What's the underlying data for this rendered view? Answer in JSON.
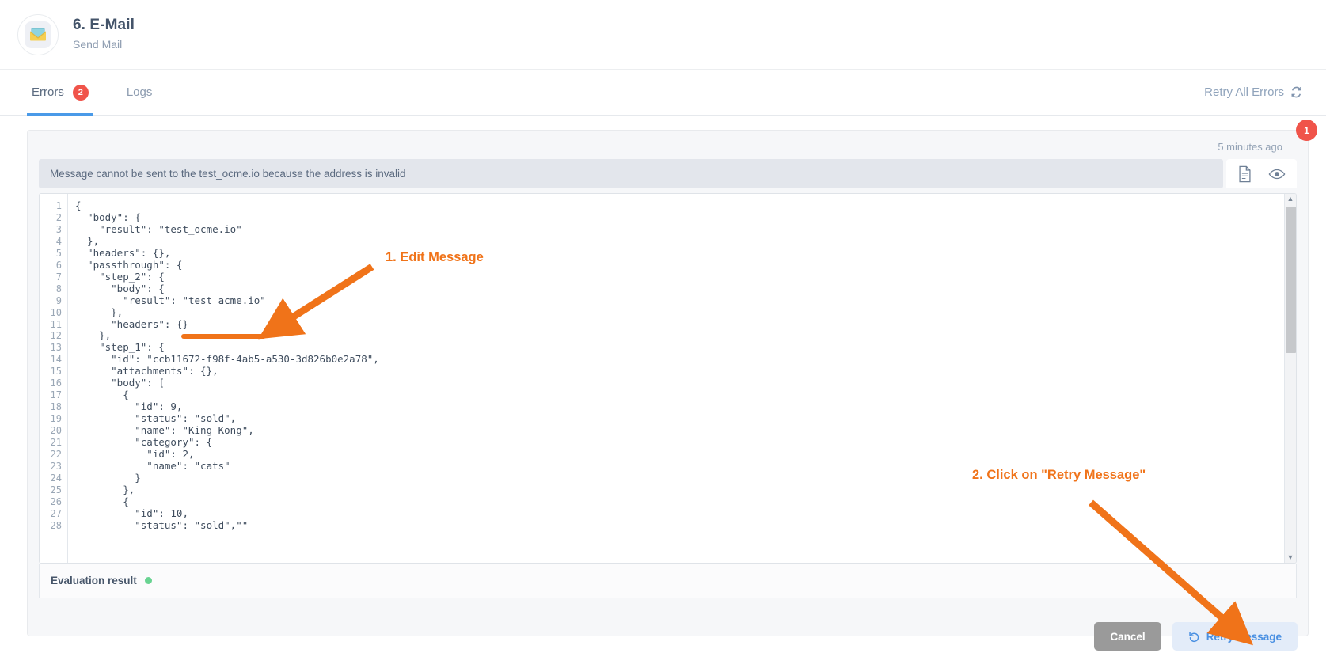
{
  "header": {
    "icon": "envelope-icon",
    "title": "6. E-Mail",
    "subtitle": "Send Mail"
  },
  "tabs": [
    {
      "label": "Errors",
      "badge": "2",
      "active": true
    },
    {
      "label": "Logs",
      "badge": "",
      "active": false
    }
  ],
  "toolbar": {
    "retry_all_label": "Retry All Errors",
    "retry_all_icon": "refresh-icon"
  },
  "panel": {
    "corner_badge": "1",
    "timestamp": "5 minutes ago",
    "error_message": "Message cannot be sent to the test_ocme.io because the address is invalid",
    "tools": [
      {
        "name": "document-icon"
      },
      {
        "name": "eye-icon"
      }
    ]
  },
  "editor": {
    "line_numbers": [
      "1",
      "2",
      "3",
      "4",
      "5",
      "6",
      "7",
      "8",
      "9",
      "10",
      "11",
      "12",
      "13",
      "14",
      "15",
      "16",
      "17",
      "18",
      "19",
      "20",
      "21",
      "22",
      "23",
      "24",
      "25",
      "26",
      "27",
      "28"
    ],
    "code": "{\n  \"body\": {\n    \"result\": \"test_ocme.io\"\n  },\n  \"headers\": {},\n  \"passthrough\": {\n    \"step_2\": {\n      \"body\": {\n        \"result\": \"test_acme.io\"\n      },\n      \"headers\": {}\n    },\n    \"step_1\": {\n      \"id\": \"ccb11672-f98f-4ab5-a530-3d826b0e2a78\",\n      \"attachments\": {},\n      \"body\": [\n        {\n          \"id\": 9,\n          \"status\": \"sold\",\n          \"name\": \"King Kong\",\n          \"category\": {\n            \"id\": 2,\n            \"name\": \"cats\"\n          }\n        },\n        {\n          \"id\": 10,\n          \"status\": \"sold\",\"\"",
    "scrollbar": {
      "up_arrow": "▲",
      "down_arrow": "▼"
    }
  },
  "evaluation": {
    "label": "Evaluation result",
    "status_color": "#68d391"
  },
  "footer": {
    "cancel_label": "Cancel",
    "retry_label": "Retry Message",
    "retry_icon": "rotate-left-icon"
  },
  "annotations": [
    {
      "text": "1. Edit Message",
      "color": "#f07319"
    },
    {
      "text": "2. Click on \"Retry Message\"",
      "color": "#f07319"
    }
  ]
}
